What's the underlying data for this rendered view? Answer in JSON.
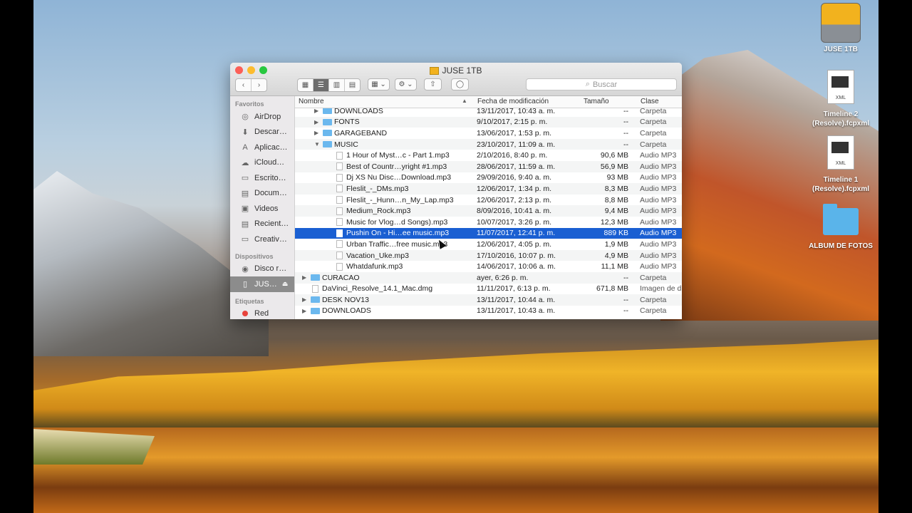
{
  "desktop": {
    "icons": [
      {
        "label": "JUSE 1TB"
      },
      {
        "label": "Timeline 2 (Resolve).fcpxml",
        "tag": "XML"
      },
      {
        "label": "Timeline 1 (Resolve).fcpxml",
        "tag": "XML"
      },
      {
        "label": "ALBUM DE FOTOS"
      }
    ]
  },
  "window": {
    "title": "JUSE 1TB",
    "search_placeholder": "Buscar",
    "toolbar_glyphs": {
      "back": "‹",
      "forward": "›",
      "arrange": "▦ ⌄",
      "action": "⚙ ⌄",
      "share": "⇧",
      "tags": "◯"
    },
    "view_glyphs": [
      "▦",
      "☰",
      "▥",
      "▤"
    ],
    "columns": {
      "name": "Nombre",
      "date": "Fecha de modificación",
      "size": "Tamaño",
      "kind": "Clase"
    },
    "sort_arrow": "▲"
  },
  "sidebar": {
    "favorites_header": "Favoritos",
    "favorites": [
      {
        "label": "AirDrop",
        "icon": "airdrop-icon",
        "glyph": "◎"
      },
      {
        "label": "Descar…",
        "icon": "downloads-icon",
        "glyph": "⬇"
      },
      {
        "label": "Aplicac…",
        "icon": "applications-icon",
        "glyph": "A"
      },
      {
        "label": "iCloud…",
        "icon": "cloud-icon",
        "glyph": "☁"
      },
      {
        "label": "Escrito…",
        "icon": "desktop-icon",
        "glyph": "▭"
      },
      {
        "label": "Docum…",
        "icon": "documents-icon",
        "glyph": "▤"
      },
      {
        "label": "Videos",
        "icon": "videos-icon",
        "glyph": "▣"
      },
      {
        "label": "Recient…",
        "icon": "recents-icon",
        "glyph": "▤"
      },
      {
        "label": "Creativ…",
        "icon": "folder-icon",
        "glyph": "▭"
      }
    ],
    "devices_header": "Dispositivos",
    "devices": [
      {
        "label": "Disco r…",
        "icon": "disk-icon",
        "glyph": "◉"
      },
      {
        "label": "JUS…",
        "icon": "drive-icon",
        "glyph": "▯",
        "eject": "⏏"
      }
    ],
    "tags_header": "Etiquetas",
    "tags": [
      {
        "label": "Red",
        "color": "#e8433c"
      }
    ]
  },
  "files": [
    {
      "name": "DOWNLOADS",
      "date": "13/11/2017, 10:43 a. m.",
      "size": "--",
      "kind": "Carpeta",
      "type": "folder",
      "level": 1,
      "tri": "▶"
    },
    {
      "name": "FONTS",
      "date": "9/10/2017, 2:15 p. m.",
      "size": "--",
      "kind": "Carpeta",
      "type": "folder",
      "level": 1,
      "tri": "▶"
    },
    {
      "name": "GARAGEBAND",
      "date": "13/06/2017, 1:53 p. m.",
      "size": "--",
      "kind": "Carpeta",
      "type": "folder",
      "level": 1,
      "tri": "▶"
    },
    {
      "name": "MUSIC",
      "date": "23/10/2017, 11:09 a. m.",
      "size": "--",
      "kind": "Carpeta",
      "type": "folder",
      "level": 1,
      "tri": "▼"
    },
    {
      "name": "1 Hour of Myst…c - Part 1.mp3",
      "date": "2/10/2016, 8:40 p. m.",
      "size": "90,6 MB",
      "kind": "Audio MP3",
      "type": "file",
      "level": 2
    },
    {
      "name": "Best of Countr…yright #1.mp3",
      "date": "28/06/2017, 11:59 a. m.",
      "size": "56,9 MB",
      "kind": "Audio MP3",
      "type": "file",
      "level": 2
    },
    {
      "name": "Dj XS Nu Disc…Download.mp3",
      "date": "29/09/2016, 9:40 a. m.",
      "size": "93 MB",
      "kind": "Audio MP3",
      "type": "file",
      "level": 2
    },
    {
      "name": "Fleslit_-_DMs.mp3",
      "date": "12/06/2017, 1:34 p. m.",
      "size": "8,3 MB",
      "kind": "Audio MP3",
      "type": "file",
      "level": 2
    },
    {
      "name": "Fleslit_-_Hunn…n_My_Lap.mp3",
      "date": "12/06/2017, 2:13 p. m.",
      "size": "8,8 MB",
      "kind": "Audio MP3",
      "type": "file",
      "level": 2
    },
    {
      "name": "Medium_Rock.mp3",
      "date": "8/09/2016, 10:41 a. m.",
      "size": "9,4 MB",
      "kind": "Audio MP3",
      "type": "file",
      "level": 2
    },
    {
      "name": "Music for Vlog…d Songs).mp3",
      "date": "10/07/2017, 3:26 p. m.",
      "size": "12,3 MB",
      "kind": "Audio MP3",
      "type": "file",
      "level": 2
    },
    {
      "name": "Pushin On - Hi…ee music.mp3",
      "date": "11/07/2017, 12:41 p. m.",
      "size": "889 KB",
      "kind": "Audio MP3",
      "type": "file",
      "level": 2,
      "selected": true
    },
    {
      "name": "Urban Traffic…free music.mp3",
      "date": "12/06/2017, 4:05 p. m.",
      "size": "1,9 MB",
      "kind": "Audio MP3",
      "type": "file",
      "level": 2
    },
    {
      "name": "Vacation_Uke.mp3",
      "date": "17/10/2016, 10:07 p. m.",
      "size": "4,9 MB",
      "kind": "Audio MP3",
      "type": "file",
      "level": 2
    },
    {
      "name": "Whatdafunk.mp3",
      "date": "14/06/2017, 10:06 a. m.",
      "size": "11,1 MB",
      "kind": "Audio MP3",
      "type": "file",
      "level": 2
    },
    {
      "name": "CURACAO",
      "date": "ayer, 6:26 p. m.",
      "size": "--",
      "kind": "Carpeta",
      "type": "folder",
      "level": 0,
      "tri": "▶"
    },
    {
      "name": "DaVinci_Resolve_14.1_Mac.dmg",
      "date": "11/11/2017, 6:13 p. m.",
      "size": "671,8 MB",
      "kind": "Imagen de di",
      "type": "dmg",
      "level": 0
    },
    {
      "name": "DESK NOV13",
      "date": "13/11/2017, 10:44 a. m.",
      "size": "--",
      "kind": "Carpeta",
      "type": "folder",
      "level": 0,
      "tri": "▶"
    },
    {
      "name": "DOWNLOADS",
      "date": "13/11/2017, 10:43 a. m.",
      "size": "--",
      "kind": "Carpeta",
      "type": "folder",
      "level": 0,
      "tri": "▶"
    }
  ]
}
